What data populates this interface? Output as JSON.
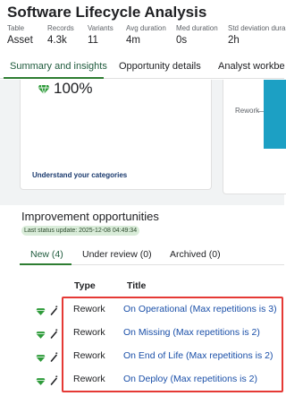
{
  "header": {
    "title": "Software Lifecycle Analysis"
  },
  "stats": [
    {
      "label": "Table",
      "value": "Asset"
    },
    {
      "label": "Records",
      "value": "4.3k"
    },
    {
      "label": "Variants",
      "value": "11"
    },
    {
      "label": "Avg duration",
      "value": "4m"
    },
    {
      "label": "Med duration",
      "value": "0s"
    },
    {
      "label": "Std deviation dura",
      "value": "2h"
    }
  ],
  "main_tabs": [
    {
      "label": "Summary and insights",
      "active": true
    },
    {
      "label": "Opportunity details"
    },
    {
      "label": "Analyst workbe"
    }
  ],
  "cards": {
    "left": {
      "percent": "100%",
      "link": "Understand your categories"
    },
    "right": {
      "bar_label": "Rework"
    }
  },
  "improvement": {
    "title": "Improvement opportunities",
    "status": "Last status update: 2025-12-08 04:49:34",
    "tabs": [
      {
        "label": "New (4)",
        "active": true
      },
      {
        "label": "Under review (0)"
      },
      {
        "label": "Archived (0)"
      }
    ],
    "columns": {
      "type": "Type",
      "title": "Title"
    },
    "rows": [
      {
        "type": "Rework",
        "title": "On Operational (Max repetitions is 3)"
      },
      {
        "type": "Rework",
        "title": "On Missing (Max repetitions is 2)"
      },
      {
        "type": "Rework",
        "title": "On End of Life (Max repetitions is 2)"
      },
      {
        "type": "Rework",
        "title": "On Deploy (Max repetitions is 2)"
      }
    ]
  },
  "colors": {
    "accent": "#2e7d32",
    "link": "#1a4fa8",
    "highlight": "#e53935",
    "bar": "#1ca0c4"
  },
  "icons": {
    "gem": "diamond-icon",
    "wand": "magic-wand-icon"
  }
}
